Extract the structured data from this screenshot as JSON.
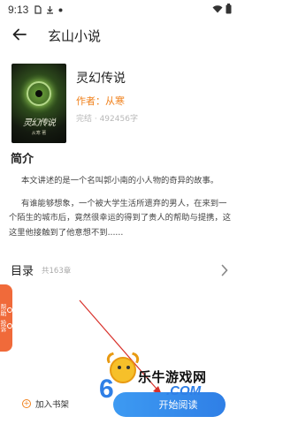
{
  "status_bar": {
    "time": "9:13"
  },
  "nav": {
    "title": "玄山小说"
  },
  "book": {
    "cover_title": "灵幻传说",
    "cover_author": "从寒 著",
    "title": "灵幻传说",
    "author_label": "作者：从寒",
    "meta": "完结 · 492456字"
  },
  "intro": {
    "heading": "简介",
    "paragraph_1": "本文讲述的是一个名叫郭小南的小人物的奇异的故事。",
    "paragraph_2": "有谁能够想象，一个被大学生活所遗弃的男人，在来到一个陌生的城市后，竟然很幸运的得到了贵人的帮助与提携，这这里他接触到了他意想不到......"
  },
  "toc": {
    "label": "目录",
    "count": "共163章"
  },
  "side_tab": {
    "help": "帮助",
    "report": "投诉"
  },
  "bottom": {
    "add_shelf": "加入书架",
    "start_read": "开始阅读"
  },
  "watermark": {
    "number": "6",
    "name": "乐牛游戏网",
    "domain": ".COM"
  },
  "colors": {
    "accent_orange": "#f0811c",
    "button_blue": "#2f7fe6",
    "side_tab": "#f06a3a"
  },
  "icons": [
    "back-arrow-icon",
    "chevron-right-icon",
    "wifi-icon",
    "battery-icon",
    "download-icon",
    "sim-icon"
  ]
}
